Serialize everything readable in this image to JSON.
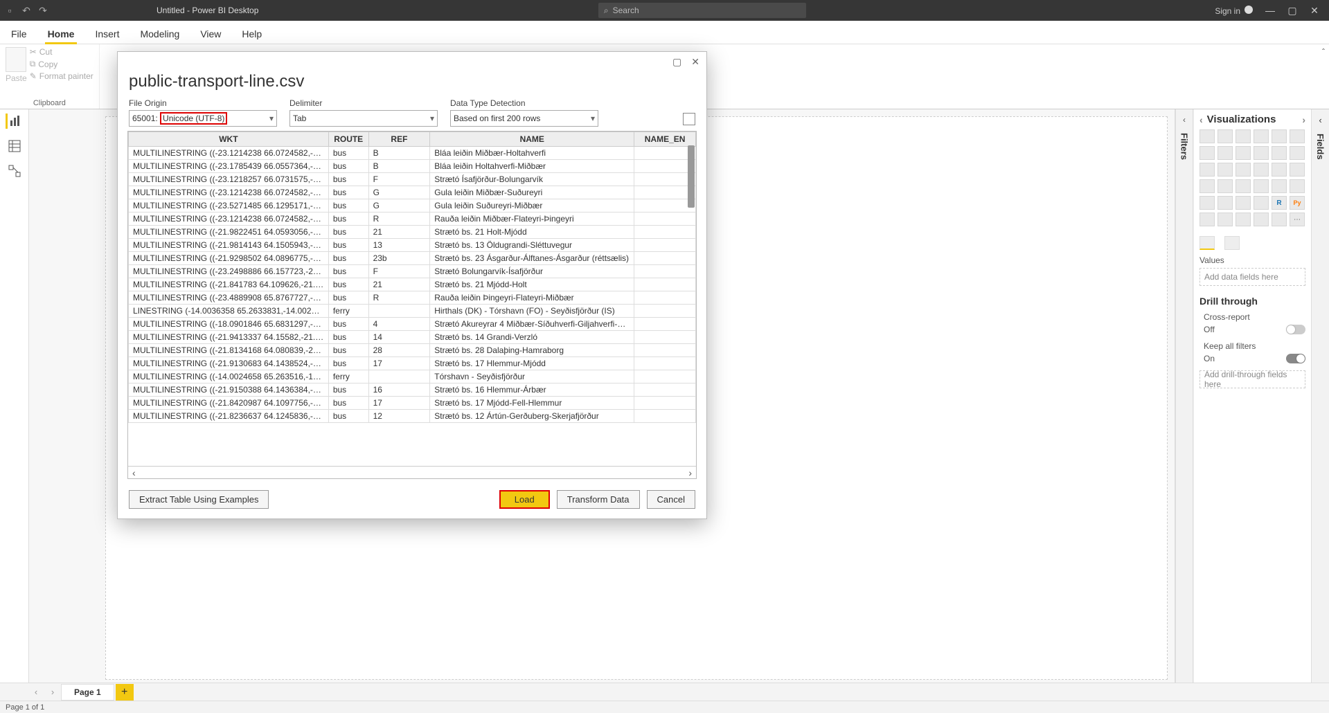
{
  "titlebar": {
    "title": "Untitled - Power BI Desktop",
    "search_placeholder": "Search",
    "signin": "Sign in"
  },
  "ribbon": {
    "tabs": [
      "File",
      "Home",
      "Insert",
      "Modeling",
      "View",
      "Help"
    ],
    "active_tab": "Home",
    "clipboard": {
      "paste": "Paste",
      "cut": "Cut",
      "copy": "Copy",
      "format": "Format painter",
      "group": "Clipboard"
    }
  },
  "viz": {
    "title": "Visualizations",
    "values_label": "Values",
    "values_placeholder": "Add data fields here",
    "drill_title": "Drill through",
    "cross_report": "Cross-report",
    "cross_report_state": "Off",
    "keep_filters": "Keep all filters",
    "keep_filters_state": "On",
    "drill_placeholder": "Add drill-through fields here"
  },
  "filters_label": "Filters",
  "fields_label": "Fields",
  "page_tab": "Page 1",
  "status": "Page 1 of 1",
  "dialog": {
    "title": "public-transport-line.csv",
    "file_origin_label": "File Origin",
    "file_origin_prefix": "65001:",
    "file_origin_value": "Unicode (UTF-8)",
    "delimiter_label": "Delimiter",
    "delimiter_value": "Tab",
    "detection_label": "Data Type Detection",
    "detection_value": "Based on first 200 rows",
    "columns": [
      "WKT",
      "ROUTE",
      "REF",
      "NAME",
      "NAME_EN"
    ],
    "rows": [
      {
        "wkt": "MULTILINESTRING ((-23.1214238 66.0724582,-23.1214...",
        "route": "bus",
        "ref": "B",
        "name": "Bláa leiðin Miðbær-Holtahverfi",
        "name_en": ""
      },
      {
        "wkt": "MULTILINESTRING ((-23.1785439 66.0557364,-23.1783...",
        "route": "bus",
        "ref": "B",
        "name": "Bláa leiðin Holtahverfi-Miðbær",
        "name_en": ""
      },
      {
        "wkt": "MULTILINESTRING ((-23.1218257 66.0731575,-23.1216...",
        "route": "bus",
        "ref": "F",
        "name": "Strætó Ísafjörður-Bolungarvík",
        "name_en": ""
      },
      {
        "wkt": "MULTILINESTRING ((-23.1214238 66.0724582,-23.1214...",
        "route": "bus",
        "ref": "G",
        "name": "Gula leiðin Miðbær-Suðureyri",
        "name_en": ""
      },
      {
        "wkt": "MULTILINESTRING ((-23.5271485 66.1295171,-23.5267...",
        "route": "bus",
        "ref": "G",
        "name": "Gula leiðin Suðureyri-Miðbær",
        "name_en": ""
      },
      {
        "wkt": "MULTILINESTRING ((-23.1214238 66.0724582,-23.1214...",
        "route": "bus",
        "ref": "R",
        "name": "Rauða leiðin Miðbær-Flateyri-Þingeyri",
        "name_en": ""
      },
      {
        "wkt": "MULTILINESTRING ((-21.9822451 64.0593056,-21.9824...",
        "route": "bus",
        "ref": "21",
        "name": "Strætó bs. 21 Holt-Mjódd",
        "name_en": ""
      },
      {
        "wkt": "MULTILINESTRING ((-21.9814143 64.1505943,-21.9810...",
        "route": "bus",
        "ref": "13",
        "name": "Strætó bs. 13 Öldugrandi-Sléttuvegur",
        "name_en": ""
      },
      {
        "wkt": "MULTILINESTRING ((-21.9298502 64.0896775,-21.9298...",
        "route": "bus",
        "ref": "23b",
        "name": "Strætó bs. 23 Ásgarður-Álftanes-Ásgarður (réttsælis)",
        "name_en": ""
      },
      {
        "wkt": "MULTILINESTRING ((-23.2498886 66.157723,-23.24997...",
        "route": "bus",
        "ref": "F",
        "name": "Strætó Bolungarvík-Ísafjörður",
        "name_en": ""
      },
      {
        "wkt": "MULTILINESTRING ((-21.841783 64.109626,-21.841660...",
        "route": "bus",
        "ref": "21",
        "name": "Strætó bs. 21 Mjódd-Holt",
        "name_en": ""
      },
      {
        "wkt": "MULTILINESTRING ((-23.4889908 65.8767727,-23.4889...",
        "route": "bus",
        "ref": "R",
        "name": "Rauða leiðin Þingeyri-Flateyri-Miðbær",
        "name_en": ""
      },
      {
        "wkt": "LINESTRING (-14.0036358 65.2633831,-14.0026678 65.5...",
        "route": "ferry",
        "ref": "",
        "name": "Hirthals (DK) - Tórshavn (FO) - Seyðisfjörður (IS)",
        "name_en": ""
      },
      {
        "wkt": "MULTILINESTRING ((-18.0901846 65.6831297,-18.0900...",
        "route": "bus",
        "ref": "4",
        "name": "Strætó Akureyrar 4 Miðbær-Síðuhverfi-Giljahverfi-Miðb...",
        "name_en": ""
      },
      {
        "wkt": "MULTILINESTRING ((-21.9413337 64.15582,-21.941345...",
        "route": "bus",
        "ref": "14",
        "name": "Strætó bs. 14 Grandi-Verzló",
        "name_en": ""
      },
      {
        "wkt": "MULTILINESTRING ((-21.8134168 64.080839,-21.81334...",
        "route": "bus",
        "ref": "28",
        "name": "Strætó bs. 28 Dalaþing-Hamraborg",
        "name_en": ""
      },
      {
        "wkt": "MULTILINESTRING ((-21.9130683 64.1438524,-21.9131...",
        "route": "bus",
        "ref": "17",
        "name": "Strætó bs. 17 Hlemmur-Mjódd",
        "name_en": ""
      },
      {
        "wkt": "MULTILINESTRING ((-14.0024658 65.263516,-14.00266...",
        "route": "ferry",
        "ref": "",
        "name": "Tórshavn - Seyðisfjörður",
        "name_en": ""
      },
      {
        "wkt": "MULTILINESTRING ((-21.9150388 64.1436384,-21.9152...",
        "route": "bus",
        "ref": "16",
        "name": "Strætó bs. 16 Hlemmur-Árbær",
        "name_en": ""
      },
      {
        "wkt": "MULTILINESTRING ((-21.8420987 64.1097756,-21.8423...",
        "route": "bus",
        "ref": "17",
        "name": "Strætó bs. 17 Mjódd-Fell-Hlemmur",
        "name_en": ""
      },
      {
        "wkt": "MULTILINESTRING ((-21.8236637 64.1245836,-21.8236...",
        "route": "bus",
        "ref": "12",
        "name": "Strætó bs. 12 Ártún-Gerðuberg-Skerjafjörður",
        "name_en": ""
      }
    ],
    "extract_btn": "Extract Table Using Examples",
    "load_btn": "Load",
    "transform_btn": "Transform Data",
    "cancel_btn": "Cancel"
  }
}
